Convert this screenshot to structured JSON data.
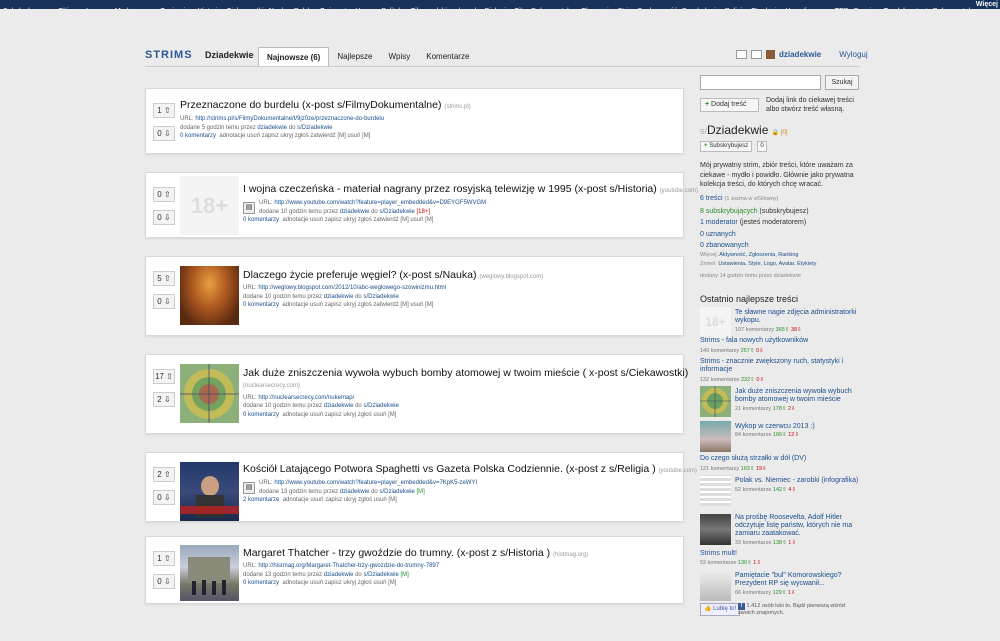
{
  "topnav": [
    "Subskrybowane",
    "Główny",
    "Losowy",
    "Moderowane",
    "Znajomi",
    "-",
    "Historia",
    "Ciekawostki",
    "Nauka",
    "Polska",
    "Zwierzęta",
    "Humor",
    "Polityka",
    "Film",
    "polskie_absurdy",
    "Biologia",
    "FilmyDokumentalne",
    "Ekonomia",
    "StrimsSpołeczność",
    "Psychologia",
    "Religia",
    "Etnologia",
    "Homofaszyzm",
    "TED",
    "Prawica",
    "Truelolcontent",
    "Dokumentalne",
    "Ki"
  ],
  "topnav_more": "Więcej",
  "logo": "STRIMS",
  "strim_name": "Dziadekwie",
  "tabs": [
    "Najnowsze (6)",
    "Najlepsze",
    "Wpisy",
    "Komentarze"
  ],
  "user": {
    "name": "dziadekwie",
    "logout": "Wyloguj"
  },
  "posts": [
    {
      "up": "1",
      "down": "0",
      "title": "Przeznaczone do burdelu (x-post s/FilmyDokumentalne)",
      "domain": "(strims.pl)",
      "url_label": "URL:",
      "url": "http://strims.pl/s/FilmyDokumentalne/t/9jz0ze/przeznaczone-do-burdelu",
      "added": "dodane 5 godzin temu przez",
      "author": "dziadekwie",
      "to": "do",
      "strim": "s/Dziadekwie",
      "comments": "0 komentarzy",
      "actions": "adnotacje   usuń   zapisz   ukryj   zgłoś   zatwierdź [M]   usuń [M]"
    },
    {
      "up": "0",
      "down": "0",
      "title": "I wojna czeczeńska - materiał nagrany przez rosyjską telewizję w 1995 (x-post s/Historia)",
      "domain": "(youtube.com)",
      "url_label": "URL:",
      "url": "http://www.youtube.com/watch?feature=player_embedded&v=D9EYGF5WVGM",
      "added": "dodane 10 godzin temu przez",
      "author": "dziadekwie",
      "to": "do",
      "strim": "s/Dziadekwie",
      "tag": "[18+]",
      "comments": "0 komentarzy",
      "actions": "adnotacje   usuń   zapisz   ukryj   zgłoś   zatwierdź [M]   usuń [M]",
      "thumb_text": "18+"
    },
    {
      "up": "5",
      "down": "0",
      "title": "Dlaczego życie preferuje węgiel? (x-post s/Nauka)",
      "domain": "(weglowy.blogspot.com)",
      "url_label": "URL:",
      "url": "http://weglowy.blogspot.com/2012/10/abc-weglowego-szowinizmu.html",
      "added": "dodane 10 godzin temu przez",
      "author": "dziadekwie",
      "to": "do",
      "strim": "s/Dziadekwie",
      "comments": "0 komentarzy",
      "actions": "adnotacje   usuń   zapisz   ukryj   zgłoś   zatwierdź [M]   usuń [M]"
    },
    {
      "up": "17",
      "down": "2",
      "title": "Jak duże zniszczenia wywoła wybuch bomby atomowej w twoim mieście ( x-post s/Ciekawostki)",
      "domain": "(nuclearsecrecy.com)",
      "url_label": "URL:",
      "url": "http://nuclearsecrecy.com/nukemap/",
      "added": "dodane 10 godzin temu przez",
      "author": "dziadekwie",
      "to": "do",
      "strim": "s/Dziadekwie",
      "comments": "0 komentarzy",
      "actions": "adnotacje   usuń   zapisz   ukryj   zgłoś   usuń [M]"
    },
    {
      "up": "2",
      "down": "0",
      "title": "Kościół Latającego Potwora Spaghetti vs Gazeta Polska Codziennie. (x-post z s/Religia )",
      "domain": "(youtube.com)",
      "url_label": "URL:",
      "url": "http://www.youtube.com/watch?feature=player_embedded&v=7KpK5-zeWYI",
      "added": "dodane 13 godzin temu przez",
      "author": "dziadekwie",
      "to": "do",
      "strim": "s/Dziadekwie",
      "tag": "[M]",
      "comments": "2 komentarze",
      "actions": "adnotacje   usuń   zapisz   ukryj   zgłoś   usuń [M]"
    },
    {
      "up": "1",
      "down": "0",
      "title": "Margaret Thatcher - trzy gwoździe do trumny. (x-post z s/Historia )",
      "domain": "(histmag.org)",
      "url_label": "URL:",
      "url": "http://histmag.org/Margaret-Thatcher-trzy-gwozdzie-do-trumny-7897",
      "added": "dodane 13 godzin temu przez",
      "author": "dziadekwie",
      "to": "do",
      "strim": "s/Dziadekwie",
      "tag": "[M]",
      "comments": "0 komentarzy",
      "actions": "adnotacje   usuń   zapisz   ukryj   zgłoś   usuń [M]"
    }
  ],
  "sidebar": {
    "search_button": "Szukaj",
    "add_button": "Dodaj treść",
    "add_hint": "Dodaj link do ciekawej treści albo stwórz treść własną.",
    "strim_prefix": "s/",
    "strim_title": "Dziadekwie",
    "strim_badge": "🔒 [0]",
    "subscribe": "Subskrybujesz",
    "unsubscribe_x": "0",
    "description": "Mój prywatny strim, zbiór treści, które uważam za ciekawe - mydło i powidło. Głównie jako prywatna kolekcja treści, do których chcę wracać.",
    "stats": [
      {
        "text": "6 treści",
        "small": "(1 ważna w s/Główny)"
      },
      {
        "text": "8 subskrybujących",
        "suffix": "(subskrybujesz)"
      },
      {
        "text": "1 moderator",
        "suffix": "(jesteś moderatorem)"
      },
      {
        "text": "0 uznanych"
      },
      {
        "text": "0 zbanowanych"
      }
    ],
    "more_label": "Więcej:",
    "more_links": "Aktywność, Zgłoszenia, Ranking",
    "change_label": "Zmień:",
    "change_links": "Ustawienia, Style, Logo, Avatar, Etykiety",
    "created": "dodany 14 godzin temu przez dziadekwie",
    "best_heading": "Ostatnio najlepsze treści",
    "best": [
      {
        "title": "Te sławne nagie zdjęcia administratorki wykopu.",
        "comments": "107 komentarzy",
        "up": "365",
        "down": "38",
        "thumb": "18+"
      },
      {
        "title": "Strims - fala nowych użytkowników",
        "comments": "140 komentarzy",
        "up": "257",
        "down": "0"
      },
      {
        "title": "Strims - znacznie zwiększony ruch, statystyki i informacje",
        "comments": "132 komentarze",
        "up": "232",
        "down": "0"
      },
      {
        "title": "Jak duże zniszczenia wywoła wybuch bomby atomowej w twoim mieście",
        "comments": "21 komentarzy",
        "up": "178",
        "down": "2"
      },
      {
        "title": "Wykop w czerwcu 2013 :)",
        "comments": "84 komentarze",
        "up": "166",
        "down": "12"
      },
      {
        "title": "Do czego służą strzałki w dół (DV)",
        "comments": "121 komentarzy",
        "up": "163",
        "down": "19"
      },
      {
        "title": "Polak vs. Niemiec - zarobki (infografika)",
        "comments": "52 komentarze",
        "up": "142",
        "down": "4"
      },
      {
        "title": "Na prośbę Roosevelta, Adolf Hitler odczytuje listę państw, których nie ma zamiaru zaatakować.",
        "comments": "33 komentarze",
        "up": "138",
        "down": "1"
      },
      {
        "title": "Strims mult!",
        "comments": "52 komentarze",
        "up": "130",
        "down": "1"
      },
      {
        "title": "Pamiętacie \"bul\" Komorowskiego? Prezydent RP się wycwanił...",
        "comments": "66 komentarzy",
        "up": "129",
        "down": "1"
      }
    ],
    "fb_like": "Lubię to!",
    "fb_text": "1.412 osób lubi to. Bądź pierwszą wśród swoich znajomych."
  }
}
